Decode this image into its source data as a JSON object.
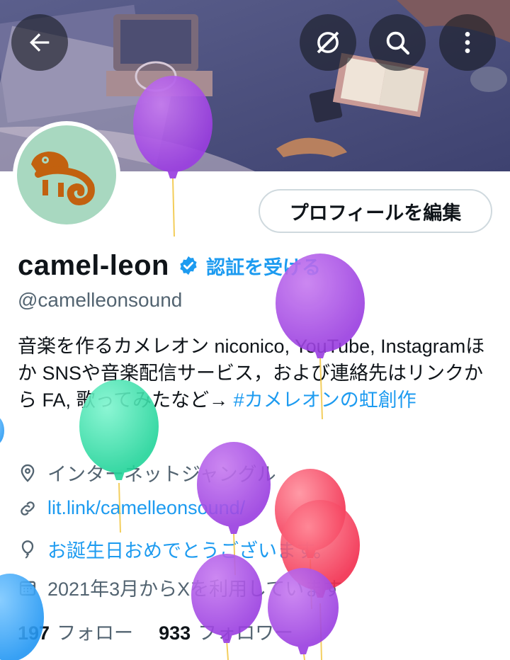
{
  "header": {
    "back_icon": "arrow-left-icon",
    "grok_icon": "grok-slash-icon",
    "search_icon": "search-icon",
    "more_icon": "more-vertical-icon"
  },
  "profile": {
    "edit_button_label": "プロフィールを編集",
    "display_name": "camel-leon",
    "verify_link": "認証を受ける",
    "handle": "@camelleonsound",
    "bio_text": "音楽を作るカメレオン niconico, YouTube, Instagramほか SNSや音楽配信サービス，および連絡先はリンクから FA, 歌ってみたなど→ ",
    "bio_hashtag": "#カメレオンの虹創作",
    "location": "インターネットジャングル",
    "website": "lit.link/camelleonsound/",
    "birthday": "お誕生日おめでとうございます。",
    "joined": "2021年3月からXを利用しています",
    "following_count": "197",
    "following_label": "フォロー",
    "followers_count": "933",
    "followers_label": "フォロワー"
  },
  "colors": {
    "accent": "#1d9bf0",
    "text": "#0f1419",
    "secondary": "#536471",
    "avatar_bg": "#a8d8c0",
    "chameleon": "#c2610f"
  }
}
